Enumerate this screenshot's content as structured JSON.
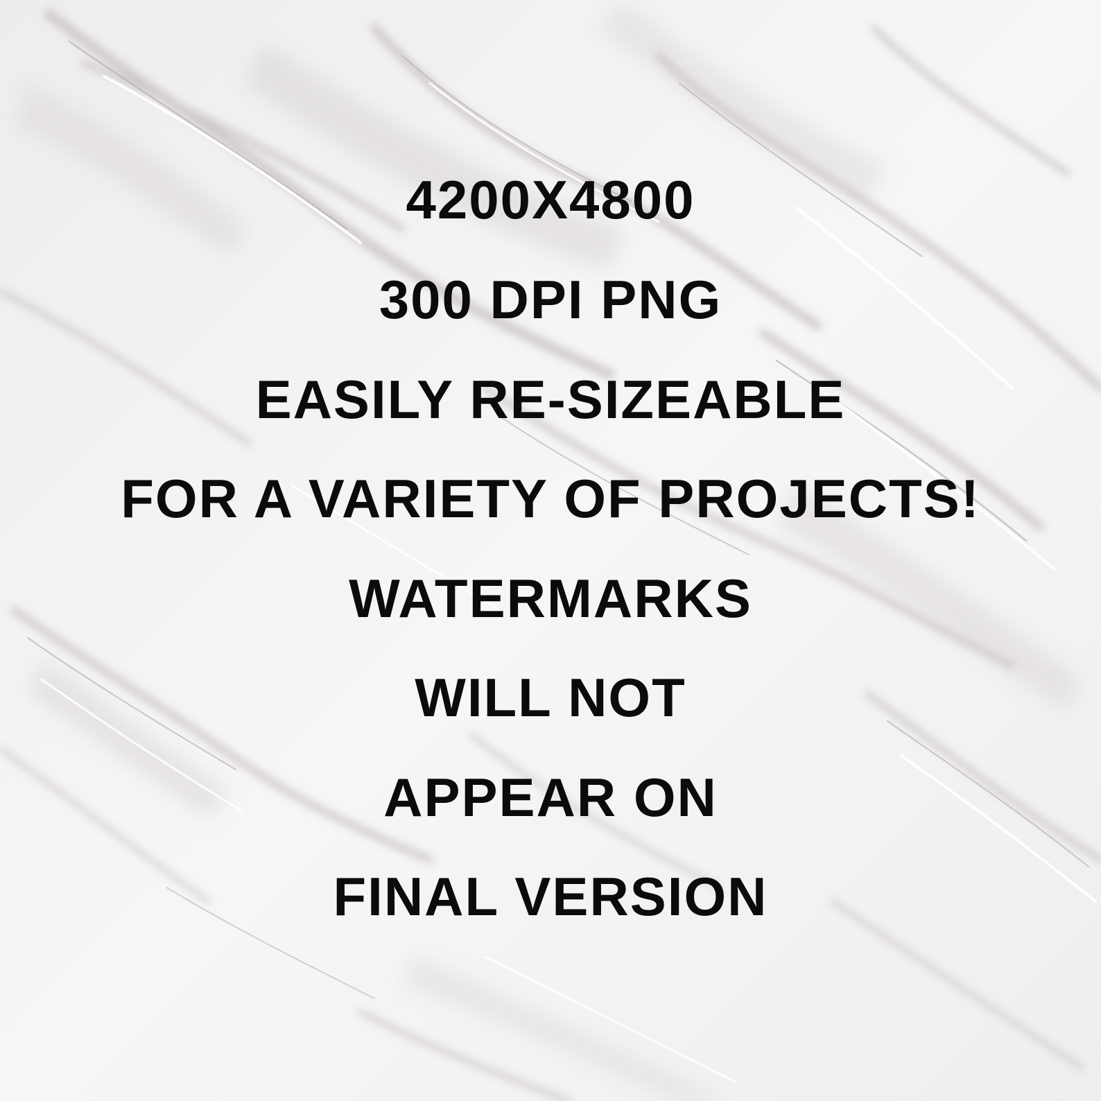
{
  "background": {
    "style": "white-marble",
    "base_color": "#f3f2f3",
    "vein_color": "#c9c2c7",
    "highlight_color": "#ffffff"
  },
  "text_color": "#0b0b0b",
  "lines": [
    "4200X4800",
    "300 DPI PNG",
    "EASILY RE-SIZEABLE",
    "FOR A VARIETY OF PROJECTS!",
    "WATERMARKS",
    "WILL NOT",
    "APPEAR ON",
    "FINAL VERSION"
  ]
}
